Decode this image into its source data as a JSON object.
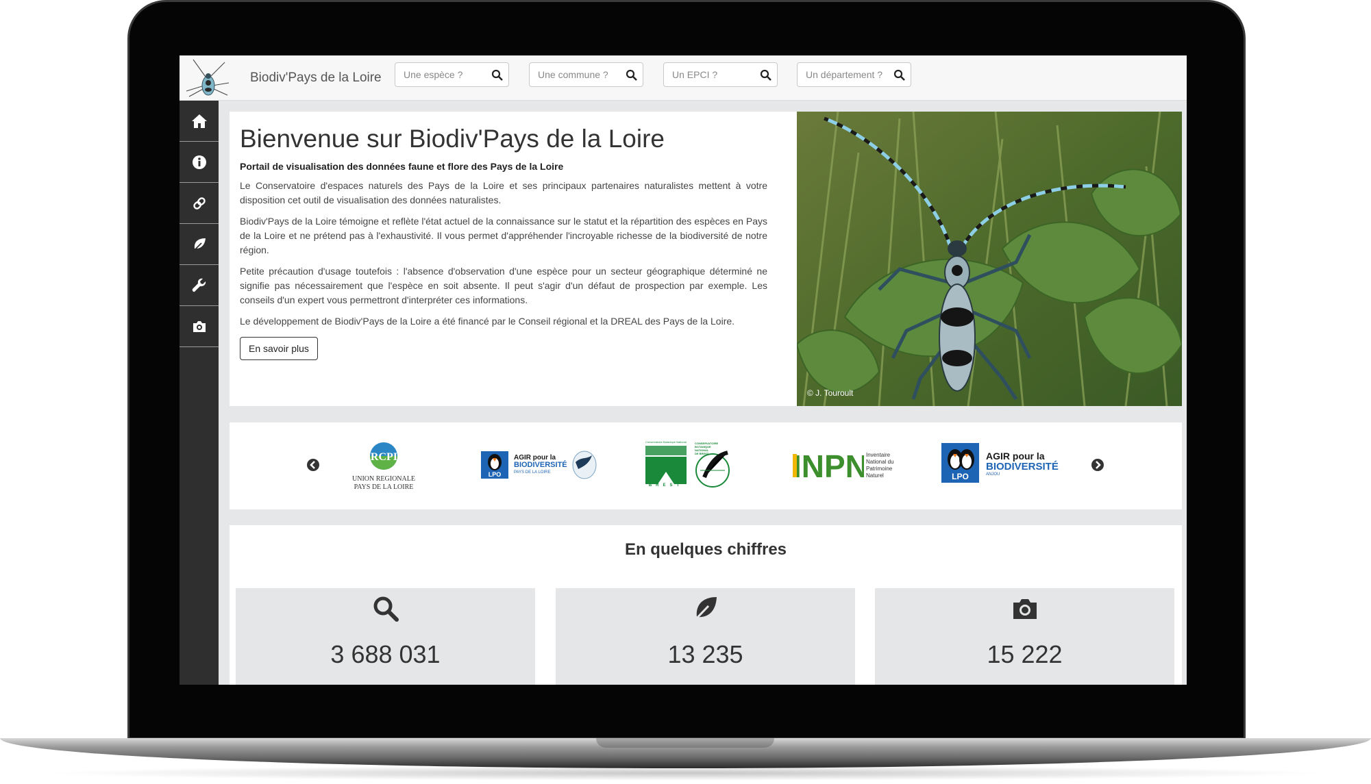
{
  "header": {
    "site_title": "Biodiv'Pays de la Loire",
    "search_species_placeholder": "Une espèce ?",
    "search_commune_placeholder": "Une commune ?",
    "search_epci_placeholder": "Un EPCI ?",
    "search_departement_placeholder": "Un département ?"
  },
  "sidebar": {
    "items": [
      "home-icon",
      "info-icon",
      "link-icon",
      "leaf-icon",
      "wrench-icon",
      "camera-icon"
    ]
  },
  "welcome": {
    "title": "Bienvenue sur Biodiv'Pays de la Loire",
    "subtitle": "Portail de visualisation des données faune et flore des Pays de la Loire",
    "paragraphs": [
      "Le Conservatoire d'espaces naturels des Pays de la Loire et ses principaux partenaires naturalistes mettent à votre disposition cet outil de visualisation des données naturalistes.",
      "Biodiv'Pays de la Loire témoigne et reflète l'état actuel de la connaissance sur le statut et la répartition des espèces en Pays de la Loire et ne prétend pas à l'exhaustivité. Il vous permet d'appréhender l'incroyable richesse de la biodiversité de notre région.",
      "Petite précaution d'usage toutefois : l'absence d'observation d'une espèce pour un secteur géographique déterminé ne signifie pas nécessairement que l'espèce en soit absente. Il peut s'agir d'un défaut de prospection par exemple. Les conseils d'un expert vous permettront d'interpréter ces informations.",
      "Le développement de Biodiv'Pays de la Loire a été financé par le Conseil régional et la DREAL des Pays de la Loire."
    ],
    "button_label": "En savoir plus",
    "photo_credit": "© J. Touroult"
  },
  "partners": {
    "logos": [
      {
        "text_main": "URCPIE",
        "line1": "UNION REGIONALE",
        "line2": "PAYS DE LA LOIRE"
      },
      {
        "badge": "LPO",
        "line1": "AGIR pour la",
        "line2": "BIODIVERSITÉ",
        "line3": "PAYS DE LA LOIRE"
      },
      {
        "top": "Conservatoire Botanique National",
        "side1": "CONSERVATOIRE",
        "side2": "BOTANIQUE",
        "side3": "NATIONAL",
        "side4": "DE BREST",
        "bottom": "BREST"
      },
      {
        "text_main": "INPN",
        "line1": "Inventaire",
        "line2": "National du",
        "line3": "Patrimoine",
        "line4": "Naturel"
      },
      {
        "badge": "LPO",
        "line1": "AGIR pour la",
        "line2": "BIODIVERSITÉ",
        "line3": "ANJOU"
      }
    ]
  },
  "numbers": {
    "title": "En quelques chiffres",
    "stats": [
      {
        "icon": "search-icon",
        "value": "3 688 031"
      },
      {
        "icon": "leaf-icon",
        "value": "13 235"
      },
      {
        "icon": "camera-icon",
        "value": "15 222"
      }
    ]
  },
  "colors": {
    "sidebar": "#2f2f2f",
    "page_background": "#e6e7e8",
    "stat_box": "#e5e6e7",
    "inpn_yellow": "#f2b705",
    "inpn_green": "#3c8f2c",
    "lpo_blue": "#1e64b4",
    "cbn_green": "#1a8a3a"
  }
}
